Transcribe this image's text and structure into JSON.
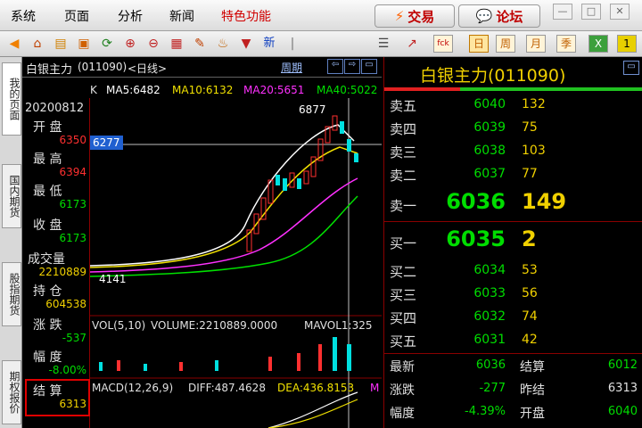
{
  "menu": {
    "items": [
      "系统",
      "页面",
      "分析",
      "新闻"
    ],
    "special": "特色功能",
    "trade_label": "交易",
    "forum_label": "论坛"
  },
  "toolbar": {
    "new_label": "新",
    "period_buttons": [
      "日",
      "周",
      "月",
      "季"
    ],
    "fck_label": "fck"
  },
  "left_tabs": [
    "我的页面",
    "国内期货",
    "股指期货",
    "期权报价"
  ],
  "chart_header": {
    "title": "白银主力",
    "code": "(011090)",
    "period": "<日线>",
    "period_button": "周期"
  },
  "ma_bar": {
    "k": "K",
    "ma5": "MA5:6482",
    "ma10": "MA10:6132",
    "ma20": "MA20:5651",
    "ma40": "MA40:5022"
  },
  "info": {
    "date": "20200812",
    "open_label": "开  盘",
    "open": "6350",
    "high_label": "最  高",
    "high": "6394",
    "low_label": "最  低",
    "low": "6173",
    "close_label": "收  盘",
    "close": "6173",
    "volume_label": "成交量",
    "volume": "2210889",
    "oi_label": "持  仓",
    "oi": "604538",
    "change_label": "涨  跌",
    "change": "-537",
    "pct_label": "幅  度",
    "pct": "-8.00%",
    "settle_label": "结  算",
    "settle": "6313"
  },
  "chart": {
    "crosshair_price": "6277",
    "high_marker": "6877",
    "low_marker": "4141",
    "vol_header": "VOL(5,10)",
    "vol_value": "VOLUME:2210889.0000",
    "mavol": "MAVOL1:325",
    "macd_header": "MACD(12,26,9)",
    "diff": "DIFF:487.4628",
    "dea": "DEA:436.8153",
    "m_label": "M"
  },
  "quote": {
    "title": "白银主力(011090)",
    "asks": [
      {
        "label": "卖五",
        "price": "6040",
        "vol": "132"
      },
      {
        "label": "卖四",
        "price": "6039",
        "vol": "75"
      },
      {
        "label": "卖三",
        "price": "6038",
        "vol": "103"
      },
      {
        "label": "卖二",
        "price": "6037",
        "vol": "77"
      },
      {
        "label": "卖一",
        "price": "6036",
        "vol": "149"
      }
    ],
    "bids": [
      {
        "label": "买一",
        "price": "6035",
        "vol": "2"
      },
      {
        "label": "买二",
        "price": "6034",
        "vol": "53"
      },
      {
        "label": "买三",
        "price": "6033",
        "vol": "56"
      },
      {
        "label": "买四",
        "price": "6032",
        "vol": "74"
      },
      {
        "label": "买五",
        "price": "6031",
        "vol": "42"
      }
    ],
    "latest_label": "最新",
    "latest": "6036",
    "settle_label": "结算",
    "settle": "6012",
    "change_label": "涨跌",
    "change": "-277",
    "prev_settle_label": "昨结",
    "prev_settle": "6313",
    "pct_label": "幅度",
    "pct": "-4.39%",
    "open_label": "开盘",
    "open": "6040"
  },
  "colors": {
    "up": "#ff3030",
    "down": "#00dd00",
    "ma5": "#ffffff",
    "ma10": "#f0e000",
    "ma20": "#ff30ff",
    "ma40": "#00e000"
  }
}
